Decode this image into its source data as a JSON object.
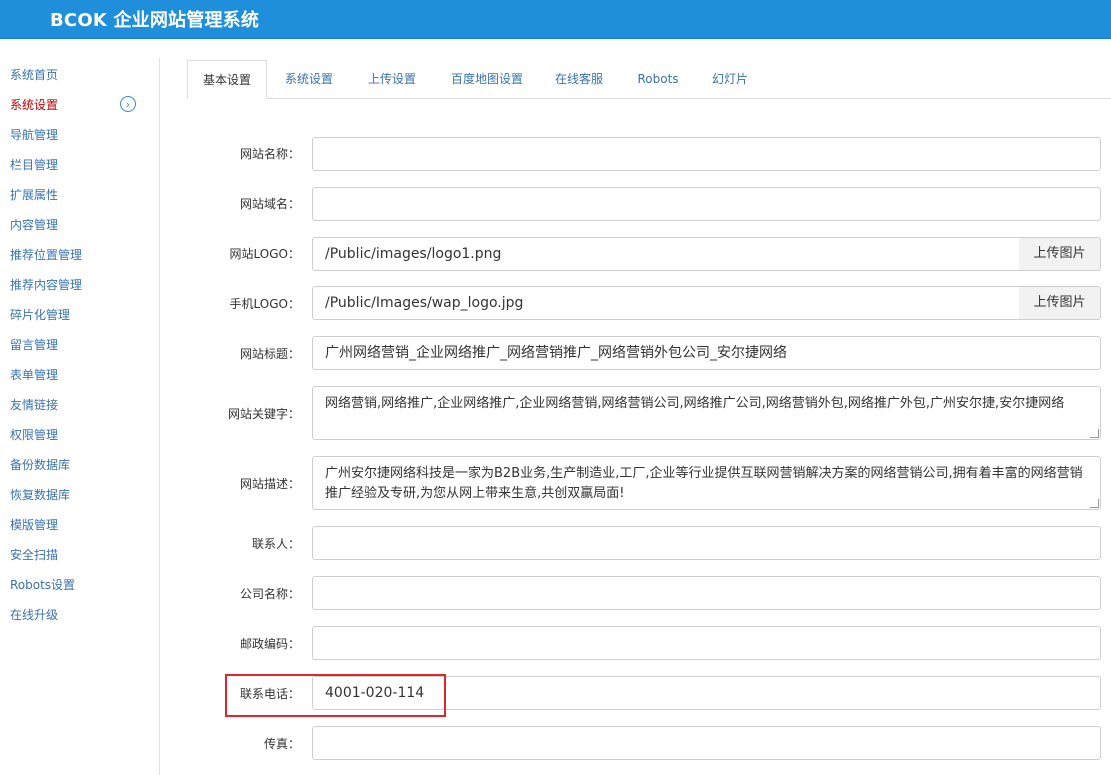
{
  "header": {
    "title": "BCOK 企业网站管理系统"
  },
  "sidebar": {
    "items": [
      {
        "label": "系统首页"
      },
      {
        "label": "系统设置"
      },
      {
        "label": "导航管理"
      },
      {
        "label": "栏目管理"
      },
      {
        "label": "扩展属性"
      },
      {
        "label": "内容管理"
      },
      {
        "label": "推荐位置管理"
      },
      {
        "label": "推荐内容管理"
      },
      {
        "label": "碎片化管理"
      },
      {
        "label": "留言管理"
      },
      {
        "label": "表单管理"
      },
      {
        "label": "友情链接"
      },
      {
        "label": "权限管理"
      },
      {
        "label": "备份数据库"
      },
      {
        "label": "恢复数据库"
      },
      {
        "label": "模版管理"
      },
      {
        "label": "安全扫描"
      },
      {
        "label": "Robots设置"
      },
      {
        "label": "在线升级"
      }
    ],
    "active_index": 1
  },
  "tabs": [
    {
      "label": "基本设置"
    },
    {
      "label": "系统设置"
    },
    {
      "label": "上传设置"
    },
    {
      "label": "百度地图设置"
    },
    {
      "label": "在线客服"
    },
    {
      "label": "Robots"
    },
    {
      "label": "幻灯片"
    }
  ],
  "form": {
    "site_name": {
      "label": "网站名称：",
      "value": ""
    },
    "site_domain": {
      "label": "网站域名：",
      "value": ""
    },
    "site_logo": {
      "label": "网站LOGO：",
      "value": "/Public/images/logo1.png",
      "button": "上传图片"
    },
    "mobile_logo": {
      "label": "手机LOGO：",
      "value": "/Public/Images/wap_logo.jpg",
      "button": "上传图片"
    },
    "site_title": {
      "label": "网站标题：",
      "value": "广州网络营销_企业网络推广_网络营销推广_网络营销外包公司_安尔捷网络"
    },
    "site_keywords": {
      "label": "网站关键字：",
      "value": "网络营销,网络推广,企业网络推广,企业网络营销,网络营销公司,网络推广公司,网络营销外包,网络推广外包,广州安尔捷,安尔捷网络"
    },
    "site_description": {
      "label": "网站描述：",
      "value": "广州安尔捷网络科技是一家为B2B业务,生产制造业,工厂,企业等行业提供互联网营销解决方案的网络营销公司,拥有着丰富的网络营销推广经验及专研,为您从网上带来生意,共创双赢局面!"
    },
    "contact_person": {
      "label": "联系人：",
      "value": ""
    },
    "company_name": {
      "label": "公司名称：",
      "value": ""
    },
    "postal_code": {
      "label": "邮政编码：",
      "value": ""
    },
    "phone": {
      "label": "联系电话：",
      "value": "4001-020-114"
    },
    "fax": {
      "label": "传真：",
      "value": ""
    }
  },
  "colors": {
    "header_bg": "#1f8fdc",
    "link": "#3a72b0",
    "active_nav": "#c00000",
    "highlight_box": "#e0262d"
  }
}
